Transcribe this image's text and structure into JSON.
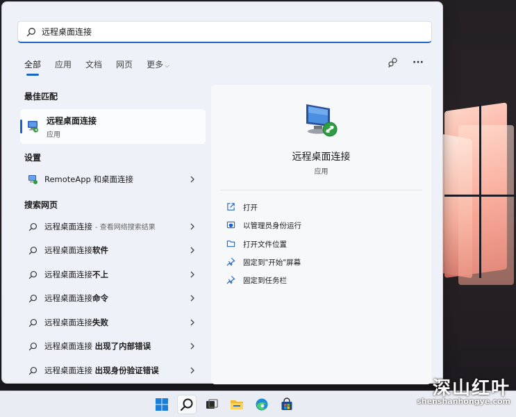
{
  "search": {
    "value": "远程桌面连接",
    "placeholder": ""
  },
  "tabs": [
    {
      "label": "全部",
      "active": true
    },
    {
      "label": "应用",
      "active": false
    },
    {
      "label": "文档",
      "active": false
    },
    {
      "label": "网页",
      "active": false
    },
    {
      "label": "更多",
      "active": false,
      "dropdown": true
    }
  ],
  "tools": {
    "share_icon": "account-share-icon",
    "more_icon": "more-ellipsis-icon",
    "more_label": "···"
  },
  "sections": {
    "best_match": "最佳匹配",
    "settings": "设置",
    "web": "搜索网页"
  },
  "best_match": {
    "name": "远程桌面连接",
    "type": "应用"
  },
  "settings_items": [
    {
      "label": "RemoteApp 和桌面连接"
    }
  ],
  "web_results": [
    {
      "prefix": "远程桌面连接",
      "bold": "",
      "suffix": "- 查看网络搜索结果"
    },
    {
      "prefix": "远程桌面连接",
      "bold": "软件",
      "suffix": ""
    },
    {
      "prefix": "远程桌面连接",
      "bold": "不上",
      "suffix": ""
    },
    {
      "prefix": "远程桌面连接",
      "bold": "命令",
      "suffix": ""
    },
    {
      "prefix": "远程桌面连接",
      "bold": "失败",
      "suffix": ""
    },
    {
      "prefix": "远程桌面连接 ",
      "bold": "出现了内部错误",
      "suffix": ""
    },
    {
      "prefix": "远程桌面连接 ",
      "bold": "出现身份验证错误",
      "suffix": ""
    }
  ],
  "preview": {
    "title": "远程桌面连接",
    "type": "应用",
    "actions": [
      {
        "label": "打开",
        "icon": "open-external-icon"
      },
      {
        "label": "以管理员身份运行",
        "icon": "shield-admin-icon"
      },
      {
        "label": "打开文件位置",
        "icon": "folder-icon"
      },
      {
        "label": "固定到\"开始\"屏幕",
        "icon": "pin-icon"
      },
      {
        "label": "固定到任务栏",
        "icon": "pin-icon"
      }
    ]
  },
  "taskbar": [
    {
      "name": "start-button",
      "icon": "windows-logo-icon"
    },
    {
      "name": "search-button",
      "icon": "search-icon",
      "active": true
    },
    {
      "name": "task-view-button",
      "icon": "task-view-icon"
    },
    {
      "name": "file-explorer-button",
      "icon": "folder-icon"
    },
    {
      "name": "edge-button",
      "icon": "edge-browser-icon"
    },
    {
      "name": "store-button",
      "icon": "store-bag-icon"
    }
  ],
  "watermark": {
    "text": "深山红叶",
    "url": "shenshanhongye.com"
  },
  "colors": {
    "accent": "#1a64c8",
    "panel_bg": "#eef1f7",
    "preview_bg": "#f7f8fa"
  }
}
